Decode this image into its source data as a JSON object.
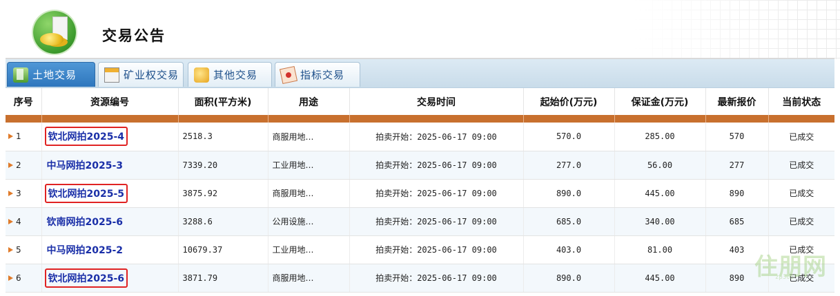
{
  "header": {
    "title": "交易公告"
  },
  "tabs": [
    {
      "label": "土地交易",
      "icon": "land-icon",
      "active": true
    },
    {
      "label": "矿业权交易",
      "icon": "mining-right-icon",
      "active": false
    },
    {
      "label": "其他交易",
      "icon": "other-trade-icon",
      "active": false
    },
    {
      "label": "指标交易",
      "icon": "quota-trade-icon",
      "active": false
    }
  ],
  "table": {
    "columns": [
      "序号",
      "资源编号",
      "面积(平方米)",
      "用途",
      "交易时间",
      "起始价(万元)",
      "保证金(万元)",
      "最新报价",
      "当前状态"
    ],
    "rows": [
      {
        "index": "1",
        "code": "钦北网拍2025-4",
        "area": "2518.3",
        "use": "商服用地…",
        "time": "拍卖开始：2025-06-17 09:00",
        "start_price": "570.0",
        "deposit": "285.00",
        "latest": "570",
        "status": "已成交",
        "highlighted": true
      },
      {
        "index": "2",
        "code": "中马网拍2025-3",
        "area": "7339.20",
        "use": "工业用地…",
        "time": "拍卖开始：2025-06-17 09:00",
        "start_price": "277.0",
        "deposit": "56.00",
        "latest": "277",
        "status": "已成交",
        "highlighted": false
      },
      {
        "index": "3",
        "code": "钦北网拍2025-5",
        "area": "3875.92",
        "use": "商服用地…",
        "time": "拍卖开始：2025-06-17 09:00",
        "start_price": "890.0",
        "deposit": "445.00",
        "latest": "890",
        "status": "已成交",
        "highlighted": true
      },
      {
        "index": "4",
        "code": "钦南网拍2025-6",
        "area": "3288.6",
        "use": "公用设施…",
        "time": "拍卖开始：2025-06-17 09:00",
        "start_price": "685.0",
        "deposit": "340.00",
        "latest": "685",
        "status": "已成交",
        "highlighted": false
      },
      {
        "index": "5",
        "code": "中马网拍2025-2",
        "area": "10679.37",
        "use": "工业用地…",
        "time": "拍卖开始：2025-06-17 09:00",
        "start_price": "403.0",
        "deposit": "81.00",
        "latest": "403",
        "status": "已成交",
        "highlighted": false
      },
      {
        "index": "6",
        "code": "钦北网拍2025-6",
        "area": "3871.79",
        "use": "商服用地…",
        "time": "拍卖开始：2025-06-17 09:00",
        "start_price": "890.0",
        "deposit": "445.00",
        "latest": "890",
        "status": "已成交",
        "highlighted": true
      }
    ]
  },
  "watermark": {
    "text": "住朋网",
    "sub": "zp365"
  },
  "colors": {
    "accent_tab": "#2e76bd",
    "header_stripe": "#c8702e",
    "link": "#1a2fa8",
    "highlight_box": "#e02222",
    "latest_price": "#c0262b",
    "status": "#e07b1e"
  }
}
